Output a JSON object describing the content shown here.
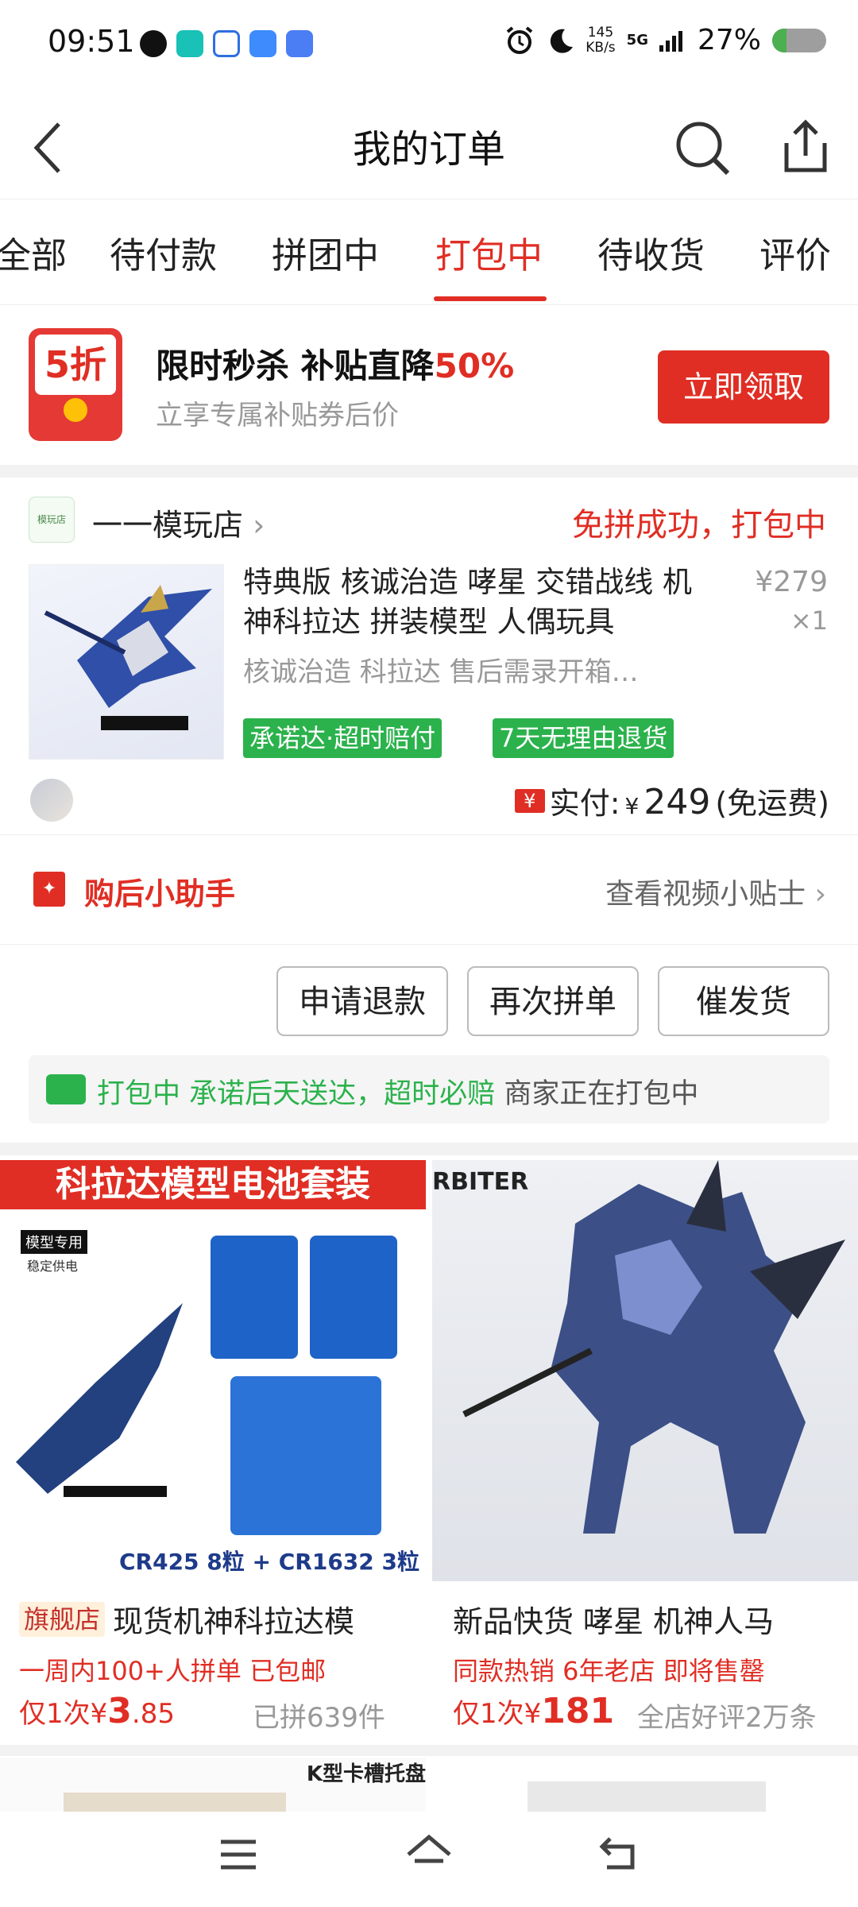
{
  "status_bar": {
    "time": "09:51",
    "speed_value": "145",
    "speed_unit": "KB/s",
    "network": "5G",
    "battery": "27%",
    "battery_level": 0.27,
    "app_icons": [
      "qq-icon",
      "taptap-icon",
      "baidu-icon",
      "files-icon",
      "browser-icon"
    ]
  },
  "header": {
    "title": "我的订单",
    "back_icon": "back-chevron-icon",
    "search_icon": "search-icon",
    "share_icon": "share-icon"
  },
  "tabs": [
    {
      "label": "全部",
      "active": false
    },
    {
      "label": "待付款",
      "active": false
    },
    {
      "label": "拼团中",
      "active": false
    },
    {
      "label": "打包中",
      "active": true
    },
    {
      "label": "待收货",
      "active": false
    },
    {
      "label": "评价",
      "active": false
    }
  ],
  "promo": {
    "envelope_text": "5折",
    "title": "限时秒杀 补贴直降",
    "title_highlight": "50%",
    "subtitle": "立享专属补贴券后价",
    "button": "立即领取"
  },
  "order": {
    "shop_icon_text": "模玩店",
    "shop_name": "一一模玩店",
    "status": "免拼成功，打包中",
    "product_title": "特典版 核诚治造 哮星 交错战线 机神科拉达  拼装模型 人偶玩具",
    "price": "¥279",
    "quantity": "×1",
    "spec": "核诚治造 科拉达  售后需录开箱…",
    "tags": [
      "承诺达·超时赔付",
      "7天无理由退货"
    ],
    "paid_icon": "¥",
    "paid_label": "实付:",
    "paid_currency": "¥",
    "paid_amount": "249",
    "paid_note": "(免运费)"
  },
  "helper": {
    "title": "购后小助手",
    "link": "查看视频小贴士"
  },
  "actions": {
    "refund": "申请退款",
    "reorder": "再次拼单",
    "urge": "催发货"
  },
  "shipping": {
    "status": "打包中",
    "promise": "承诺后天送达，超时必赔",
    "note": "商家正在打包中"
  },
  "recommendations": [
    {
      "banner": "科拉达模型电池套装",
      "image_labels": [
        "模型专用",
        "稳定供电",
        "CR425 8粒 + CR1632 3粒"
      ],
      "badge": "旗舰店",
      "title": "现货机神科拉达模",
      "subtitle": "一周内100+人拼单  已包邮",
      "price_prefix": "仅1次",
      "price_currency": "¥",
      "price_int": "3",
      "price_dec": ".85",
      "sold": "已拼639件"
    },
    {
      "banner": "RBITER",
      "title": "新品快货 哮星 机神人马",
      "subtitle": "同款热销  6年老店  即将售罄",
      "price_prefix": "仅1次",
      "price_currency": "¥",
      "price_int": "181",
      "sold": "全店好评2万条"
    }
  ],
  "next_row": {
    "label": "K型卡槽托盘"
  },
  "nav": {
    "menu_icon": "menu-icon",
    "home_icon": "home-icon",
    "back_icon": "back-icon"
  },
  "colors": {
    "accent": "#e02e24",
    "green": "#2bb24c",
    "grey_text": "#999999"
  }
}
